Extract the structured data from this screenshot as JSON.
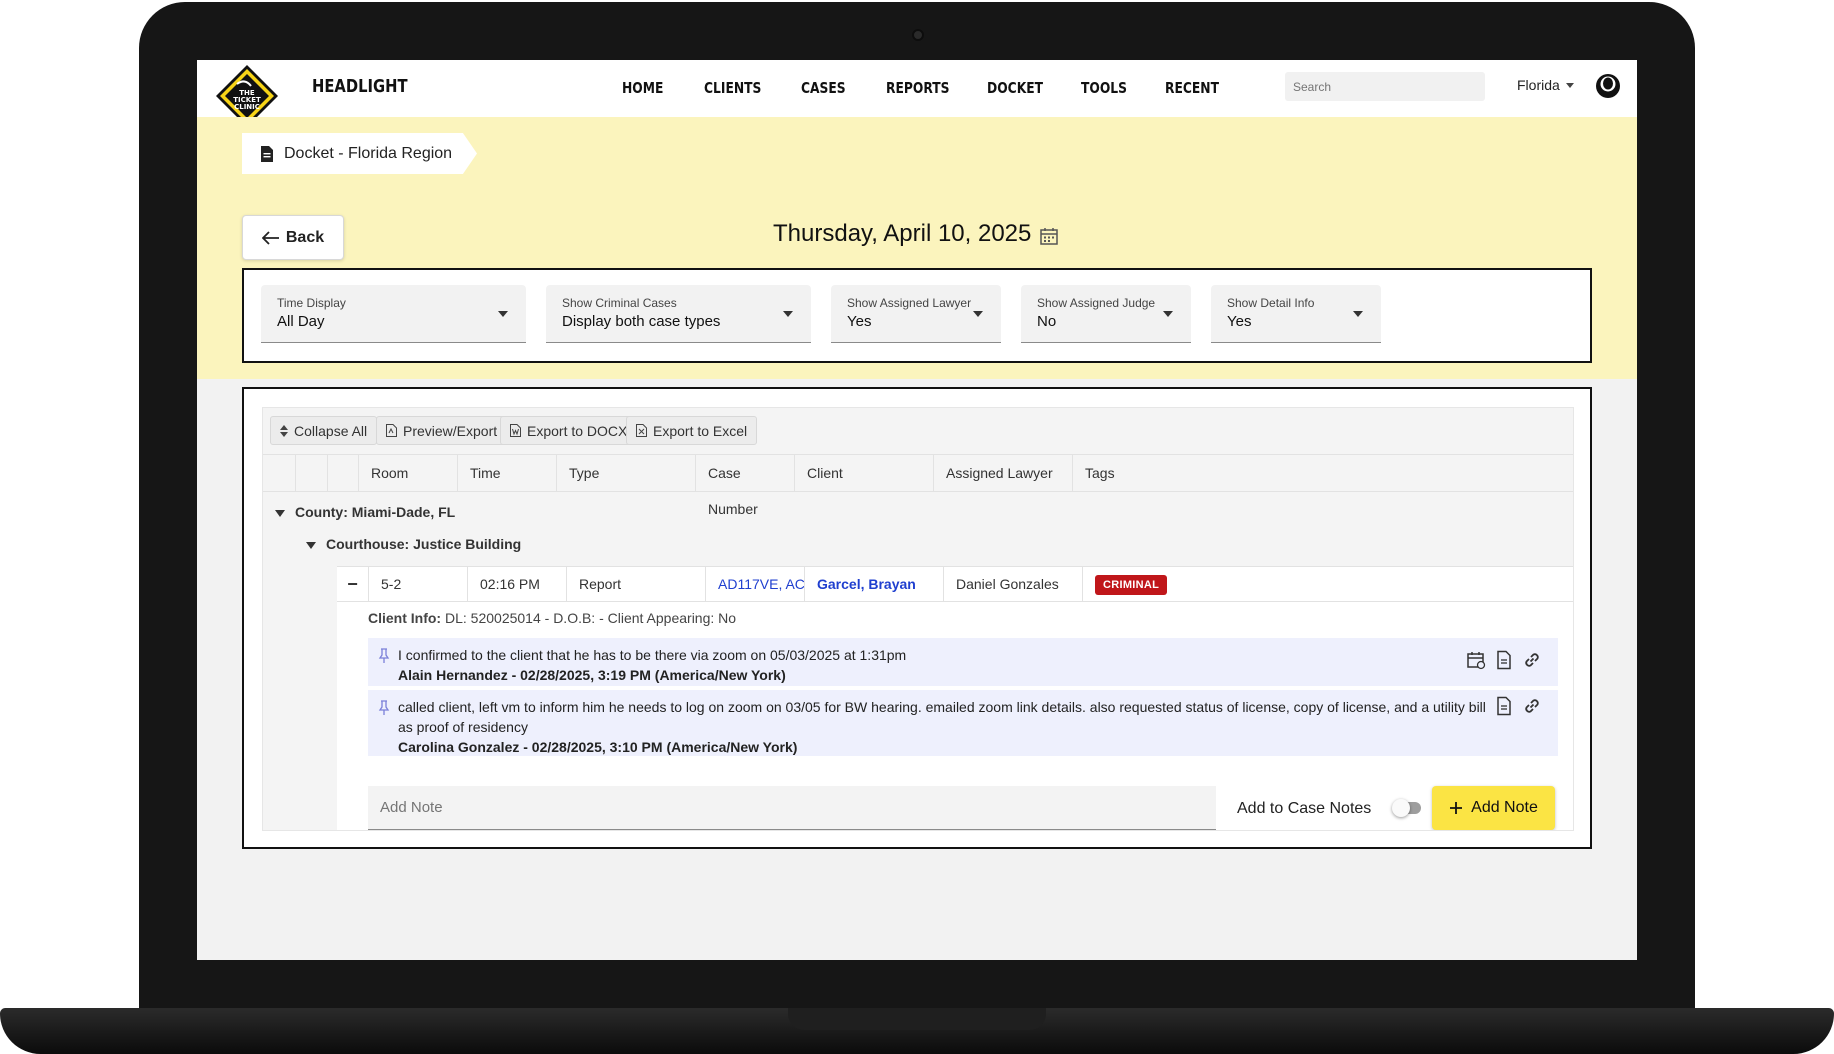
{
  "app": {
    "title": "HEADLIGHT",
    "logo_text": "THE TICKET CLINIC A LAW FIRM"
  },
  "nav": {
    "items": [
      "HOME",
      "CLIENTS",
      "CASES",
      "REPORTS",
      "DOCKET",
      "TOOLS",
      "RECENT"
    ]
  },
  "search": {
    "placeholder": "Search"
  },
  "region": {
    "selected": "Florida"
  },
  "breadcrumb": {
    "label": "Docket - Florida Region"
  },
  "back": {
    "label": "Back"
  },
  "date": {
    "title": "Thursday, April 10, 2025"
  },
  "filters": [
    {
      "label": "Time Display",
      "value": "All Day"
    },
    {
      "label": "Show Criminal Cases",
      "value": "Display both case types"
    },
    {
      "label": "Show Assigned Lawyer",
      "value": "Yes"
    },
    {
      "label": "Show Assigned Judge",
      "value": "No"
    },
    {
      "label": "Show Detail Info",
      "value": "Yes"
    }
  ],
  "toolbar": {
    "collapse_all": "Collapse All",
    "preview_export": "Preview/Export",
    "export_docx": "Export to DOCX",
    "export_excel": "Export to Excel"
  },
  "table": {
    "columns": [
      "Room",
      "Time",
      "Type",
      "Case Number",
      "Client",
      "Assigned Lawyer",
      "Tags"
    ],
    "county_group": "County: Miami-Dade, FL",
    "courthouse_group": "Courthouse: Justice Building",
    "rows": [
      {
        "room": "5-2",
        "time": "02:16 PM",
        "type": "Report",
        "case_number": "AD117VE, AC...",
        "client": "Garcel, Brayan",
        "lawyer": "Daniel Gonzales",
        "tag": "CRIMINAL",
        "tag_color": "#c0161a"
      }
    ]
  },
  "detail": {
    "client_info_label": "Client Info:",
    "client_info_value": "DL: 520025014 - D.O.B: - Client Appearing: No",
    "notes": [
      {
        "text": "I confirmed to the client that he has to be there via zoom on 05/03/2025 at 1:31pm",
        "author": "Alain Hernandez - 02/28/2025, 3:19 PM (America/New York)"
      },
      {
        "text": "called client, left vm to inform him he needs to log on zoom on 03/05 for BW hearing. emailed zoom link details. also requested status of license, copy of license, and a utility bill as proof of residency",
        "author": "Carolina Gonzalez - 02/28/2025, 3:10 PM (America/New York)"
      }
    ],
    "add_note_placeholder": "Add Note",
    "add_to_case_notes_label": "Add to Case Notes",
    "add_note_button": "Add Note"
  },
  "colors": {
    "accent_yellow": "#fbe444",
    "header_yellow": "#fbf4bd",
    "link_blue": "#1f3fcf",
    "note_bg": "#eef0fd"
  }
}
